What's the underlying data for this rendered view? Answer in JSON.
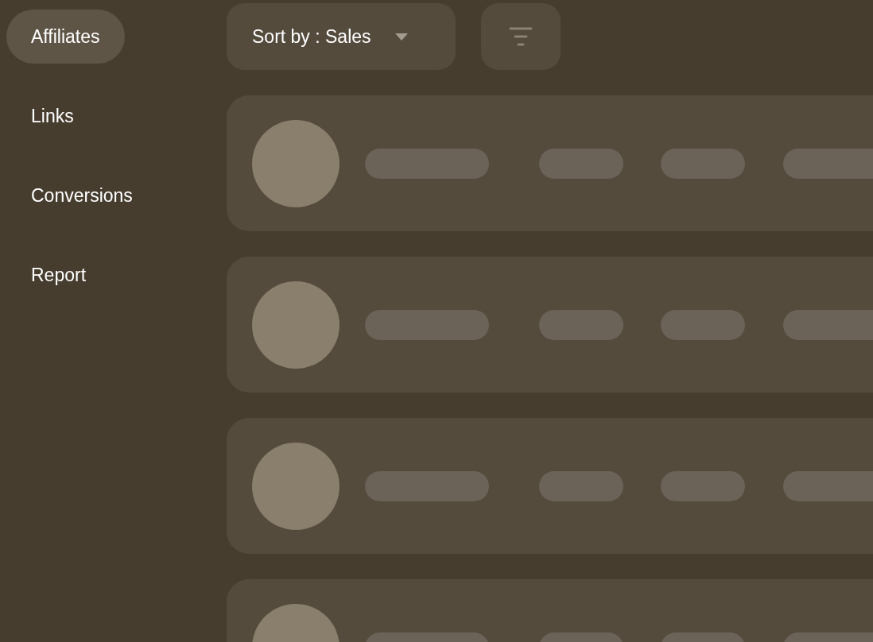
{
  "sidebar": {
    "items": [
      {
        "label": "Affiliates",
        "selected": true
      },
      {
        "label": "Links",
        "selected": false
      },
      {
        "label": "Conversions",
        "selected": false
      },
      {
        "label": "Report",
        "selected": false
      }
    ]
  },
  "toolbar": {
    "sort": {
      "label": "Sort by : Sales"
    }
  },
  "rows": [
    {
      "kind": "skeleton"
    },
    {
      "kind": "skeleton"
    },
    {
      "kind": "skeleton"
    },
    {
      "kind": "skeleton"
    }
  ]
}
